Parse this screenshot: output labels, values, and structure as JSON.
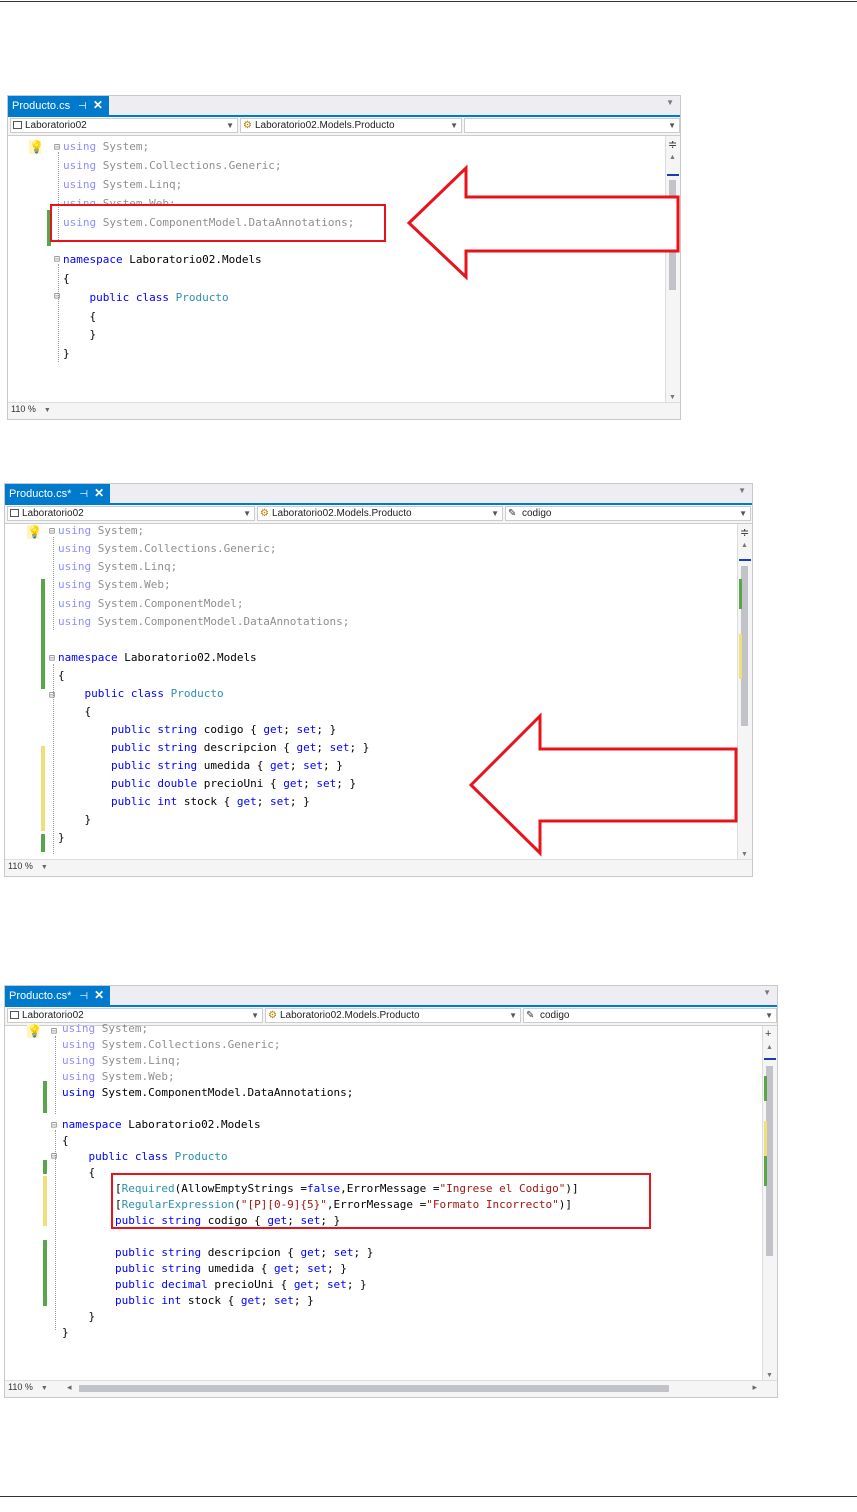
{
  "screenshots": [
    {
      "tab": {
        "title": "Producto.cs",
        "pin": "⊣",
        "close": "✕"
      },
      "nav": {
        "project": "Laboratorio02",
        "class": "Laboratorio02.Models.Producto",
        "member": ""
      },
      "zoom": "110 %",
      "code": [
        "using System;",
        "using System.Collections.Generic;",
        "using System.Linq;",
        "using System.Web;",
        "using System.ComponentModel.DataAnnotations;",
        "",
        "namespace Laboratorio02.Models",
        "{",
        "    public class Producto",
        "    {",
        "    }",
        "}"
      ]
    },
    {
      "tab": {
        "title": "Producto.cs*",
        "pin": "⊣",
        "close": "✕"
      },
      "nav": {
        "project": "Laboratorio02",
        "class": "Laboratorio02.Models.Producto",
        "member": "codigo"
      },
      "zoom": "110 %",
      "code": [
        "using System;",
        "using System.Collections.Generic;",
        "using System.Linq;",
        "using System.Web;",
        "using System.ComponentModel;",
        "using System.ComponentModel.DataAnnotations;",
        "",
        "namespace Laboratorio02.Models",
        "{",
        "    public class Producto",
        "    {",
        "        public string codigo { get; set; }",
        "        public string descripcion { get; set; }",
        "        public string umedida { get; set; }",
        "        public double precioUni { get; set; }",
        "        public int stock { get; set; }",
        "    }",
        "}"
      ]
    },
    {
      "tab": {
        "title": "Producto.cs*",
        "pin": "⊣",
        "close": "✕"
      },
      "nav": {
        "project": "Laboratorio02",
        "class": "Laboratorio02.Models.Producto",
        "member": "codigo"
      },
      "zoom": "110 %",
      "code": [
        "using System;",
        "using System.Collections.Generic;",
        "using System.Linq;",
        "using System.Web;",
        "using System.ComponentModel.DataAnnotations;",
        "",
        "namespace Laboratorio02.Models",
        "{",
        "    public class Producto",
        "    {",
        "        [Required(AllowEmptyStrings =false,ErrorMessage =\"Ingrese el Codigo\")]",
        "        [RegularExpression(\"[P][0-9]{5}\",ErrorMessage =\"Formato Incorrecto\")]",
        "        public string codigo { get; set; }",
        "",
        "        public string descripcion { get; set; }",
        "        public string umedida { get; set; }",
        "        public decimal precioUni { get; set; }",
        "        public int stock { get; set; }",
        "    }",
        "}"
      ]
    }
  ]
}
